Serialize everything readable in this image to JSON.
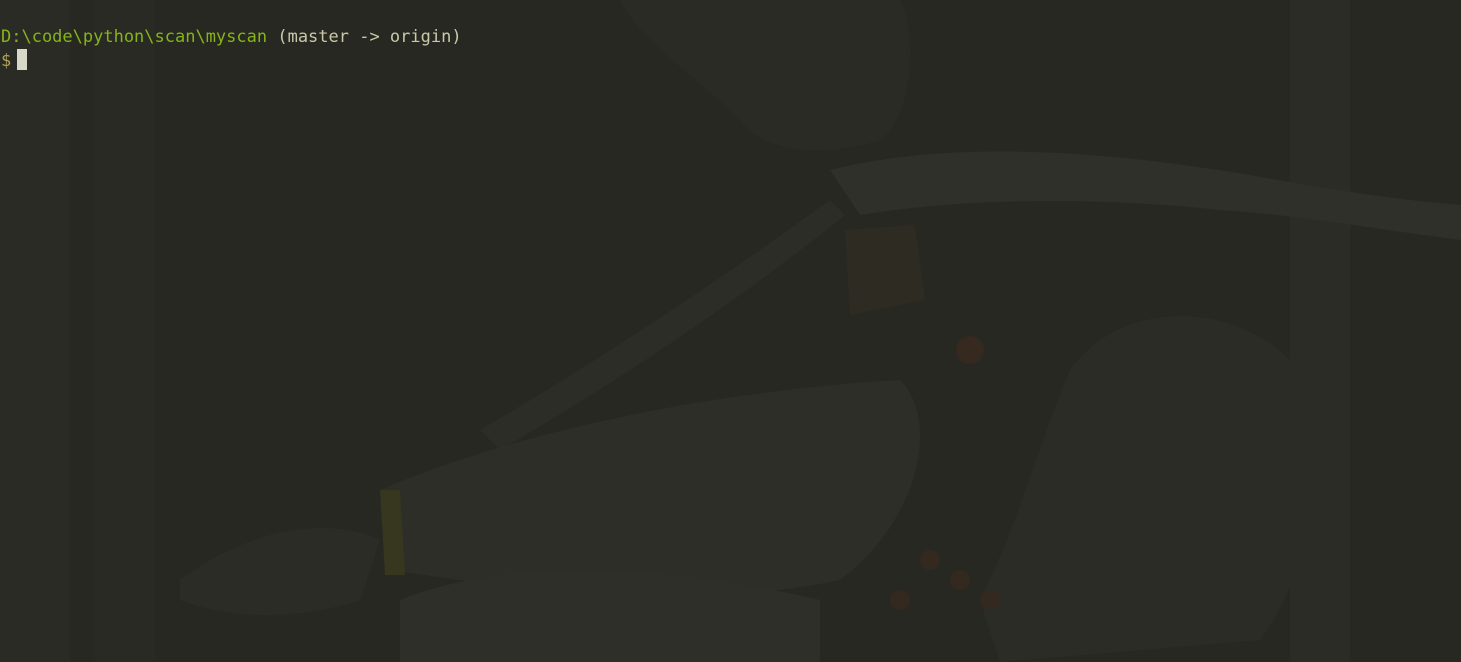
{
  "terminal": {
    "cwd_path": "D:\\code\\python\\scan\\myscan",
    "git_info": " (master -> origin)",
    "prompt_symbol": "$"
  },
  "colors": {
    "background": "#272822",
    "path": "#86b31a",
    "git_info": "#c9c9a8",
    "prompt": "#b1a256",
    "cursor": "#d8d8c8"
  },
  "icons": {
    "cursor": "block-cursor-icon"
  }
}
